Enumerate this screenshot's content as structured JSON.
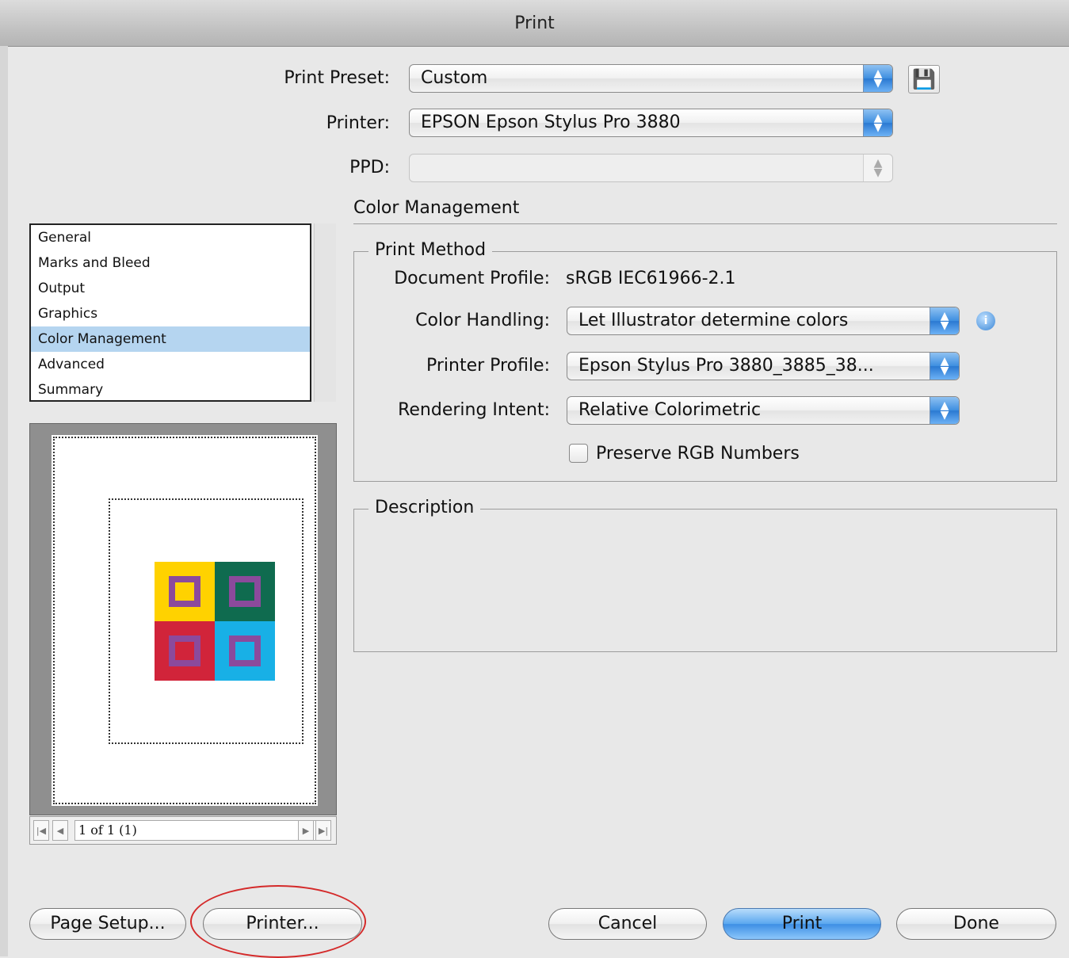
{
  "window": {
    "title": "Print"
  },
  "top": {
    "print_preset_label": "Print Preset:",
    "print_preset_value": "Custom",
    "printer_label": "Printer:",
    "printer_value": "EPSON Epson Stylus Pro 3880",
    "ppd_label": "PPD:",
    "ppd_value": ""
  },
  "section": {
    "title": "Color Management"
  },
  "print_method": {
    "legend": "Print Method",
    "document_profile_label": "Document Profile:",
    "document_profile_value": "sRGB IEC61966-2.1",
    "color_handling_label": "Color Handling:",
    "color_handling_value": "Let Illustrator determine colors",
    "printer_profile_label": "Printer Profile:",
    "printer_profile_value": "Epson Stylus Pro 3880_3885_38...",
    "rendering_intent_label": "Rendering Intent:",
    "rendering_intent_value": "Relative Colorimetric",
    "preserve_rgb_label": "Preserve RGB Numbers",
    "preserve_rgb_checked": false
  },
  "description": {
    "legend": "Description",
    "text": ""
  },
  "sidebar": {
    "items": [
      {
        "label": "General"
      },
      {
        "label": "Marks and Bleed"
      },
      {
        "label": "Output"
      },
      {
        "label": "Graphics"
      },
      {
        "label": "Color Management"
      },
      {
        "label": "Advanced"
      },
      {
        "label": "Summary"
      }
    ],
    "selected": "Color Management"
  },
  "preview": {
    "tile_colors": [
      "#ffd200",
      "#0f6b4f",
      "#d1243a",
      "#18b0e6"
    ],
    "square_color": "#8b4a9c"
  },
  "pager": {
    "text": "1 of 1 (1)"
  },
  "buttons": {
    "page_setup": "Page Setup...",
    "printer": "Printer...",
    "cancel": "Cancel",
    "print": "Print",
    "done": "Done"
  }
}
